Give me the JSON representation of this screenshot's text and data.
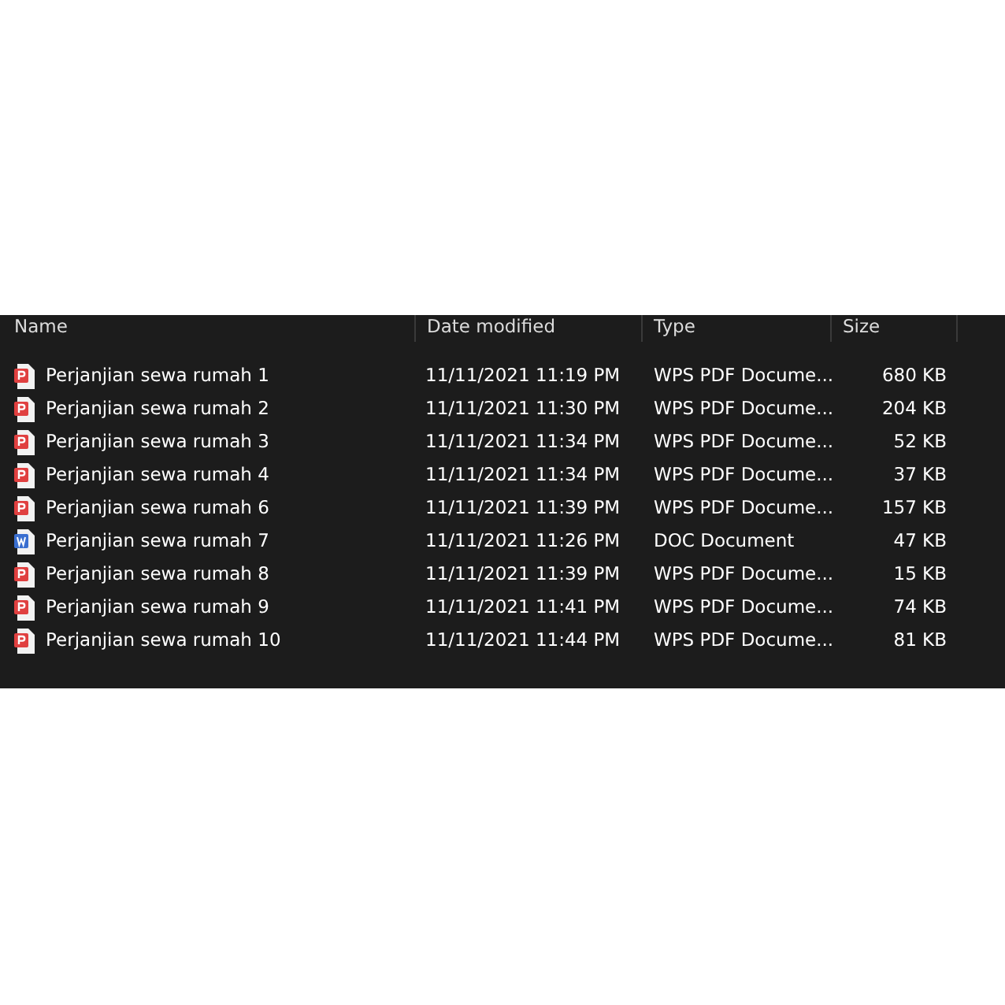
{
  "columns": [
    "Name",
    "Date modified",
    "Type",
    "Size"
  ],
  "files": [
    {
      "name": "Perjanjian sewa rumah 1",
      "date": "11/11/2021 11:19 PM",
      "type": "WPS PDF Docume...",
      "size": "680 KB",
      "kind": "pdf"
    },
    {
      "name": "Perjanjian sewa rumah 2",
      "date": "11/11/2021 11:30 PM",
      "type": "WPS PDF Docume...",
      "size": "204 KB",
      "kind": "pdf"
    },
    {
      "name": "Perjanjian sewa rumah 3",
      "date": "11/11/2021 11:34 PM",
      "type": "WPS PDF Docume...",
      "size": "52 KB",
      "kind": "pdf"
    },
    {
      "name": "Perjanjian sewa rumah 4",
      "date": "11/11/2021 11:34 PM",
      "type": "WPS PDF Docume...",
      "size": "37 KB",
      "kind": "pdf"
    },
    {
      "name": "Perjanjian sewa rumah 6",
      "date": "11/11/2021 11:39 PM",
      "type": "WPS PDF Docume...",
      "size": "157 KB",
      "kind": "pdf"
    },
    {
      "name": "Perjanjian sewa rumah 7",
      "date": "11/11/2021 11:26 PM",
      "type": "DOC Document",
      "size": "47 KB",
      "kind": "doc"
    },
    {
      "name": "Perjanjian sewa rumah 8",
      "date": "11/11/2021 11:39 PM",
      "type": "WPS PDF Docume...",
      "size": "15 KB",
      "kind": "pdf"
    },
    {
      "name": "Perjanjian sewa rumah 9",
      "date": "11/11/2021 11:41 PM",
      "type": "WPS PDF Docume...",
      "size": "74 KB",
      "kind": "pdf"
    },
    {
      "name": "Perjanjian sewa rumah 10",
      "date": "11/11/2021 11:44 PM",
      "type": "WPS PDF Docume...",
      "size": "81 KB",
      "kind": "pdf"
    }
  ]
}
